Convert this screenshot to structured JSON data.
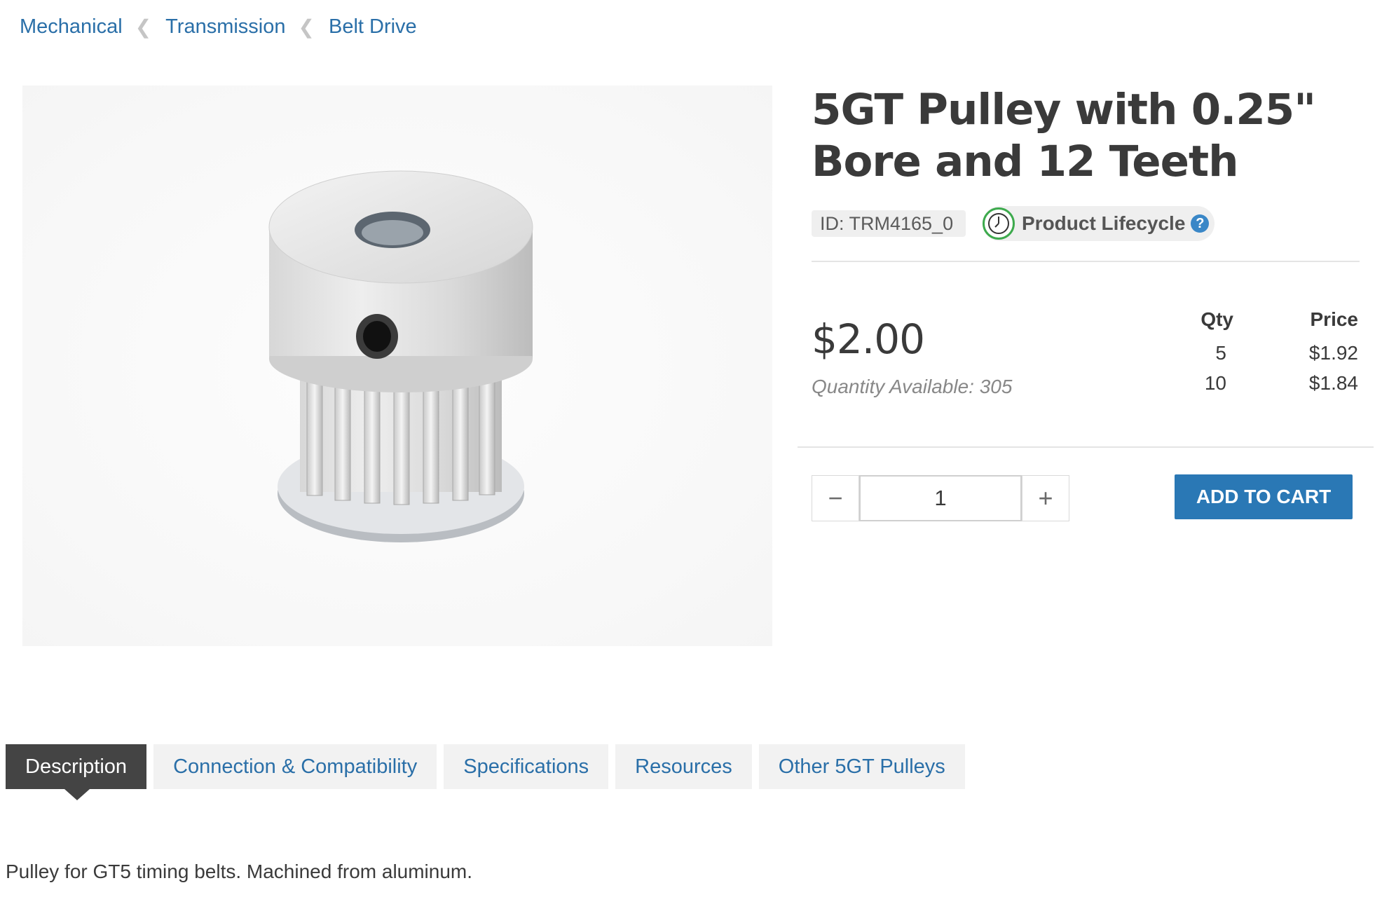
{
  "breadcrumb": {
    "items": [
      "Mechanical",
      "Transmission",
      "Belt Drive"
    ],
    "separator": "❮"
  },
  "product": {
    "title": "5GT Pulley with 0.25\" Bore and 12 Teeth",
    "id_text": "ID: TRM4165_0",
    "lifecycle_label": "Product Lifecycle",
    "help_glyph": "?",
    "price": "$2.00",
    "availability": "Quantity Available: 305"
  },
  "pricing_table": {
    "qty_header": "Qty",
    "price_header": "Price",
    "rows": [
      {
        "qty": "5",
        "price": "$1.92"
      },
      {
        "qty": "10",
        "price": "$1.84"
      }
    ]
  },
  "cart": {
    "decrement_glyph": "−",
    "increment_glyph": "+",
    "quantity": "1",
    "add_label": "ADD TO CART"
  },
  "tabs": [
    {
      "label": "Description",
      "active": true
    },
    {
      "label": "Connection & Compatibility",
      "active": false
    },
    {
      "label": "Specifications",
      "active": false
    },
    {
      "label": "Resources",
      "active": false
    },
    {
      "label": "Other 5GT Pulleys",
      "active": false
    }
  ],
  "description": "Pulley for GT5 timing belts. Machined from aluminum.",
  "colors": {
    "link": "#2a6fa8",
    "button": "#2a78b5",
    "active_tab": "#444444",
    "lifecycle_ring": "#3daa4d",
    "help_icon": "#3a87c7"
  },
  "icons": {
    "lifecycle": "clock-icon",
    "help": "question-icon",
    "breadcrumb_separator": "chevron-left-icon"
  }
}
